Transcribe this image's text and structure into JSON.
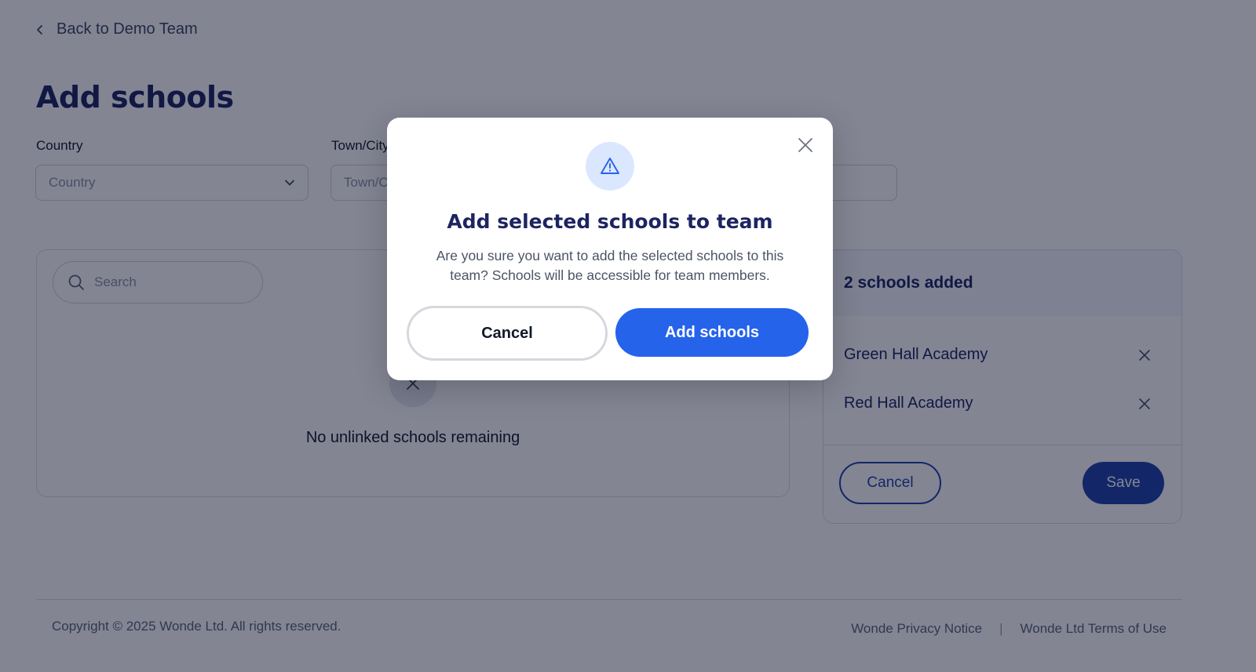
{
  "back_link": {
    "label": "Back to Demo Team",
    "icon": "chevron-left-icon"
  },
  "page_title": "Add schools",
  "filters": {
    "country": {
      "label": "Country",
      "placeholder": "Country",
      "icon": "chevron-down-icon"
    },
    "town": {
      "label": "Town/City",
      "placeholder": "Town/City"
    }
  },
  "left_panel": {
    "search_placeholder": "Search",
    "search_icon": "search-icon",
    "empty_icon": "close-icon",
    "empty_text": "No unlinked schools remaining"
  },
  "right_panel": {
    "header": "2 schools added",
    "schools": [
      {
        "name": "Green Hall Academy"
      },
      {
        "name": "Red Hall Academy"
      }
    ],
    "cancel_label": "Cancel",
    "save_label": "Save"
  },
  "footer": {
    "copyright": "Copyright © 2025 Wonde Ltd. All rights reserved.",
    "links": [
      "Wonde Privacy Notice",
      "Wonde Ltd Terms of Use"
    ],
    "separator": "|"
  },
  "modal": {
    "icon": "warning-icon",
    "title": "Add selected schools to team",
    "body": "Are you sure you want to add the selected schools to this team? Schools will be accessible for team members.",
    "cancel_label": "Cancel",
    "confirm_label": "Add schools"
  },
  "colors": {
    "brand_navy": "#1d2460",
    "primary_blue": "#2563eb",
    "save_blue": "#1f43a8",
    "icon_bg": "#dbe7ff"
  }
}
